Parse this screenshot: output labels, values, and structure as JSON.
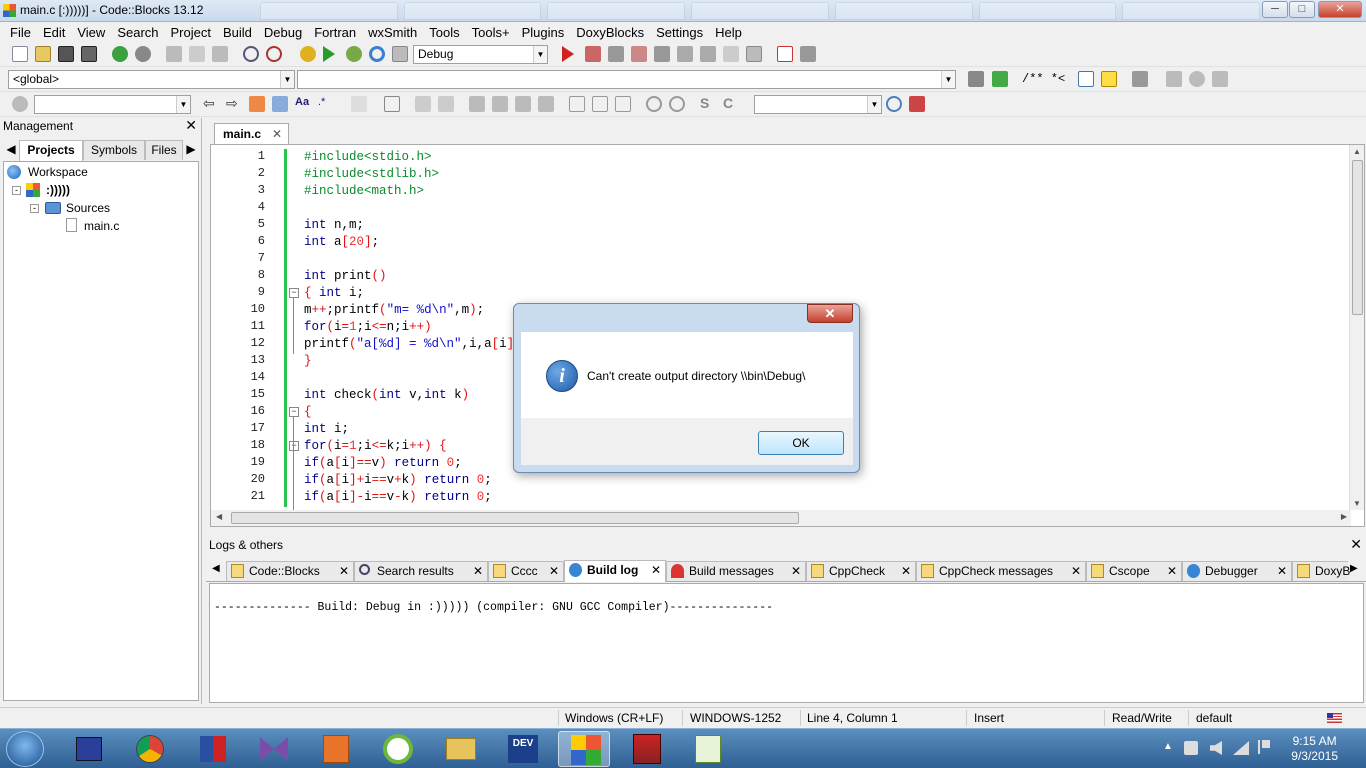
{
  "window": {
    "title": "main.c [:)))))] - Code::Blocks 13.12",
    "minimize": "─",
    "maximize": "□",
    "close": "✕"
  },
  "menu": [
    "File",
    "Edit",
    "View",
    "Search",
    "Project",
    "Build",
    "Debug",
    "Fortran",
    "wxSmith",
    "Tools",
    "Tools+",
    "Plugins",
    "DoxyBlocks",
    "Settings",
    "Help"
  ],
  "toolbar": {
    "build_target": "Debug",
    "scope": "<global>",
    "function": "",
    "search": "",
    "doxy_comment": "/** *<"
  },
  "management": {
    "title": "Management",
    "tabs": [
      "Projects",
      "Symbols",
      "Files"
    ],
    "tree": {
      "workspace": "Workspace",
      "project": ":)))))",
      "sources": "Sources",
      "file": "main.c"
    }
  },
  "editor": {
    "tab": "main.c",
    "line_numbers": [
      "1",
      "2",
      "3",
      "4",
      "5",
      "6",
      "7",
      "8",
      "9",
      "10",
      "11",
      "12",
      "13",
      "14",
      "15",
      "16",
      "17",
      "18",
      "19",
      "20",
      "21"
    ]
  },
  "logs": {
    "title": "Logs & others",
    "tabs": [
      "Code::Blocks",
      "Search results",
      "Cccc",
      "Build log",
      "Build messages",
      "CppCheck",
      "CppCheck messages",
      "Cscope",
      "Debugger",
      "DoxyB"
    ],
    "active_tab": "Build log",
    "build_line": "-------------- Build: Debug in :))))) (compiler: GNU GCC Compiler)---------------"
  },
  "status": {
    "eol": "Windows (CR+LF)",
    "encoding": "WINDOWS-1252",
    "position": "Line 4, Column 1",
    "mode": "Insert",
    "access": "Read/Write",
    "profile": "default"
  },
  "dialog": {
    "message": "Can't create output directory \\\\bin\\Debug\\",
    "ok": "OK",
    "close": "✕",
    "icon": "info-icon"
  },
  "taskbar": {
    "time": "9:15 AM",
    "date": "9/3/2015",
    "dev_label": "DEV"
  },
  "colors": {
    "change_bar": "#27c34a",
    "keyword": "#00008b",
    "preprocessor": "#0a8a2a",
    "number": "#f03030",
    "string": "#1010c8"
  }
}
